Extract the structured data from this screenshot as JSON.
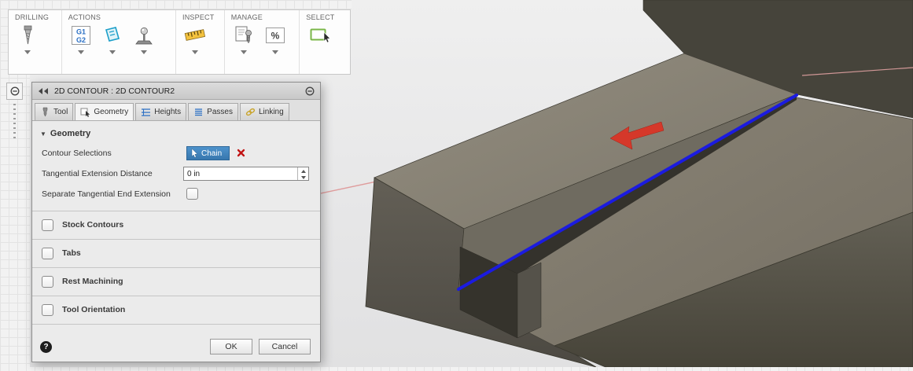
{
  "toolbar": {
    "sections": [
      {
        "label": "DRILLING"
      },
      {
        "label": "ACTIONS"
      },
      {
        "label": "INSPECT"
      },
      {
        "label": "MANAGE"
      },
      {
        "label": "SELECT"
      }
    ],
    "g1g2": {
      "top": "G1",
      "bottom": "G2"
    },
    "percent": "%"
  },
  "dialog": {
    "title": "2D CONTOUR : 2D CONTOUR2",
    "tabs": [
      {
        "label": "Tool"
      },
      {
        "label": "Geometry"
      },
      {
        "label": "Heights"
      },
      {
        "label": "Passes"
      },
      {
        "label": "Linking"
      }
    ],
    "active_tab": "Geometry",
    "geometry_section": {
      "title": "Geometry",
      "contour_selections_label": "Contour Selections",
      "chain_button_label": "Chain",
      "tangential_label": "Tangential Extension Distance",
      "tangential_value": "0 in",
      "separate_label": "Separate Tangential End Extension",
      "separate_checked": false
    },
    "groups": [
      {
        "label": "Stock Contours",
        "checked": false
      },
      {
        "label": "Tabs",
        "checked": false
      },
      {
        "label": "Rest Machining",
        "checked": false
      },
      {
        "label": "Tool Orientation",
        "checked": false
      }
    ],
    "footer": {
      "help": "?",
      "ok": "OK",
      "cancel": "Cancel"
    }
  },
  "viewport": {
    "selection_color": "#1b1be0",
    "direction_arrow_color": "#d5382a",
    "axis_line_color": "#df9c9c",
    "model_top_color": "#8b8578",
    "model_side_color": "#56534b",
    "select_icon_color": "#7ab648"
  }
}
